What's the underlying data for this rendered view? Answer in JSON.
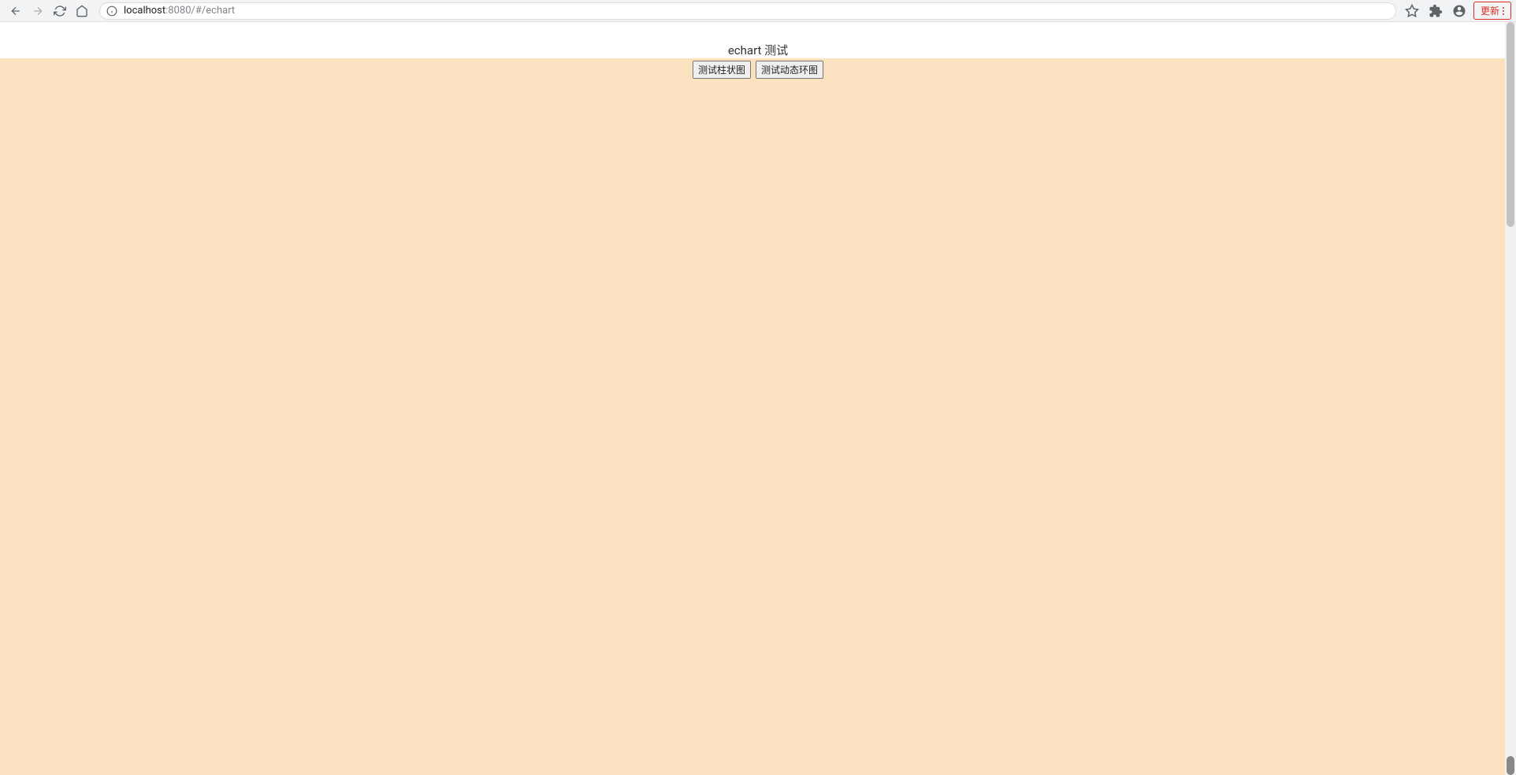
{
  "browser": {
    "url_host": "localhost",
    "url_port_path": ":8080/#/echart",
    "update_label": "更新"
  },
  "page": {
    "title": "echart 测试",
    "buttons": {
      "bar": "测试柱状图",
      "ring": "测试动态环图"
    }
  }
}
